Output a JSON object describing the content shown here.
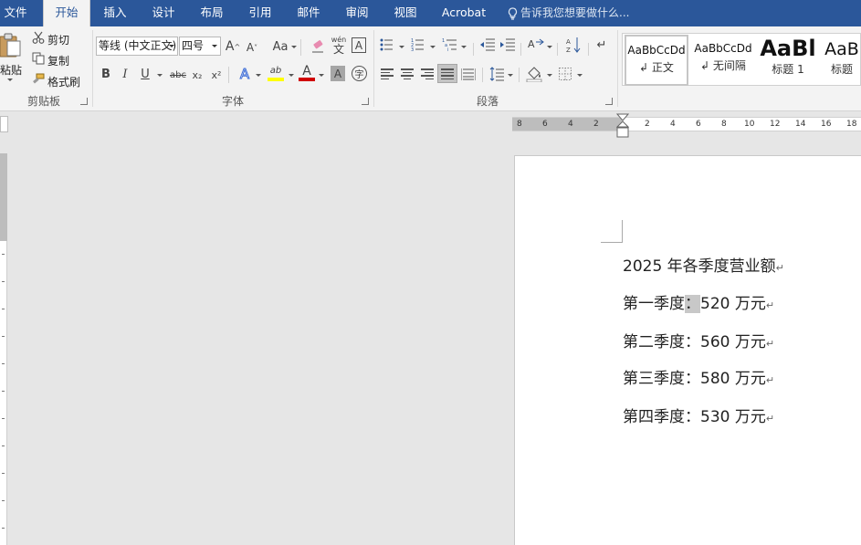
{
  "tabs": [
    {
      "label": "文件",
      "active": false
    },
    {
      "label": "开始",
      "active": true
    },
    {
      "label": "插入",
      "active": false
    },
    {
      "label": "设计",
      "active": false
    },
    {
      "label": "布局",
      "active": false
    },
    {
      "label": "引用",
      "active": false
    },
    {
      "label": "邮件",
      "active": false
    },
    {
      "label": "审阅",
      "active": false
    },
    {
      "label": "视图",
      "active": false
    },
    {
      "label": "Acrobat",
      "active": false
    }
  ],
  "tell_me": {
    "placeholder": "告诉我您想要做什么..."
  },
  "clipboard": {
    "paste_label": "粘贴",
    "cut_label": "剪切",
    "copy_label": "复制",
    "format_painter_label": "格式刷",
    "group_label": "剪贴板"
  },
  "font": {
    "font_name": "等线 (中文正文)",
    "font_size": "四号",
    "grow_label": "A",
    "shrink_label": "A",
    "case_label": "Aa",
    "phonetic_label": "wén",
    "bold_label": "B",
    "italic_label": "I",
    "underline_label": "U",
    "strike_label": "abc",
    "subscript_label": "x₂",
    "superscript_label": "x²",
    "effects_label": "A",
    "highlight_label": "ab",
    "font_color_label": "A",
    "shading_label": "A",
    "enclose_label": "字",
    "group_label": "字体",
    "highlight_color": "#ffff00",
    "font_color": "#d00000"
  },
  "paragraph": {
    "group_label": "段落"
  },
  "styles": [
    {
      "preview": "AaBbCcDd",
      "name": "正文",
      "selected": true
    },
    {
      "preview": "AaBbCcDd",
      "name": "无间隔",
      "selected": false
    },
    {
      "preview": "AaBl",
      "name": "标题 1",
      "selected": false
    },
    {
      "preview": "AaB",
      "name": "标题",
      "selected": false
    }
  ],
  "ruler": {
    "left_numbers": [
      "8",
      "6",
      "4",
      "2"
    ],
    "right_numbers": [
      "2",
      "4",
      "6",
      "8",
      "10",
      "12",
      "14",
      "16",
      "18"
    ]
  },
  "document": {
    "lines": [
      {
        "text": "2025 年各季度营业额"
      },
      {
        "label": "第一季度",
        "sep": "：",
        "value": "520 万元"
      },
      {
        "label": "第二季度",
        "sep": "：",
        "value": "560 万元"
      },
      {
        "label": "第三季度",
        "sep": "：",
        "value": "580 万元"
      },
      {
        "label": "第四季度",
        "sep": "：",
        "value": "530 万元"
      }
    ],
    "paragraph_mark": "↵"
  }
}
